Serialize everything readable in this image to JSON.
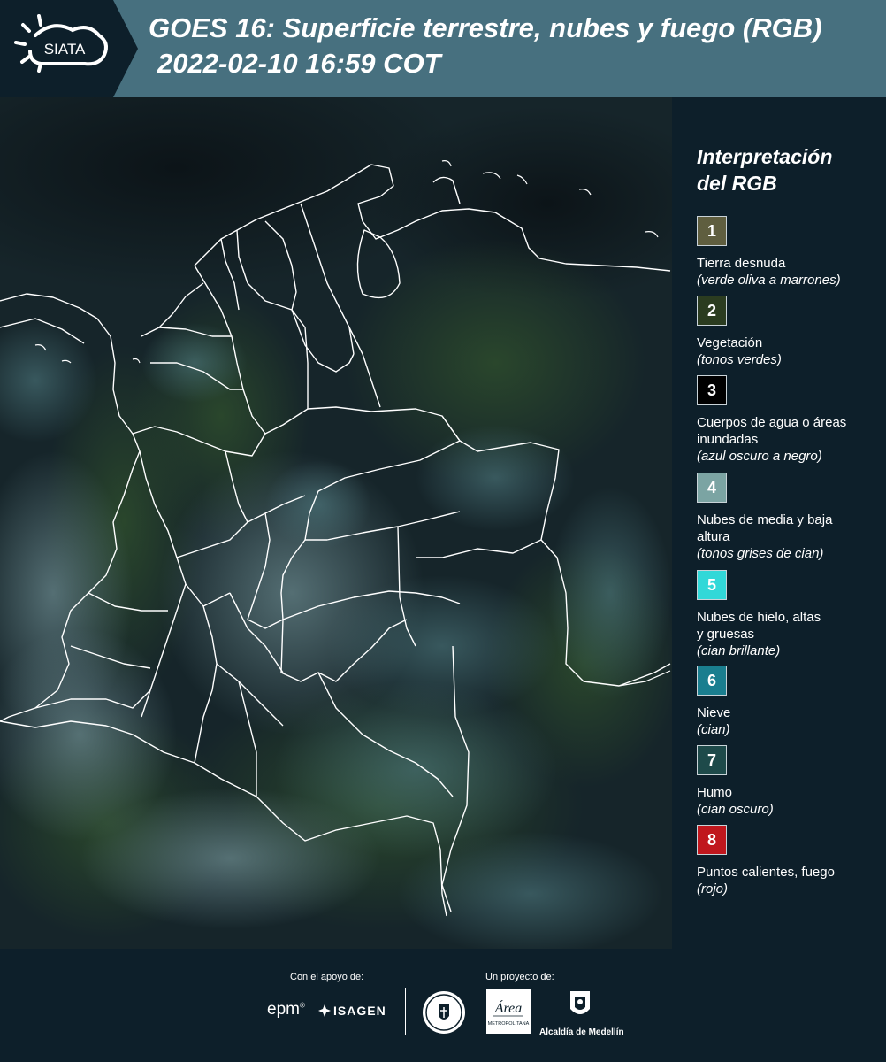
{
  "header": {
    "logo_text": "SIATA",
    "title_line1": "GOES 16: Superficie terrestre, nubes y fuego (RGB)",
    "title_line2": "2022-02-10 16:59 COT"
  },
  "colors": {
    "header_bg": "#47707f",
    "page_bg": "#0d1f2a",
    "map_bg": "#101c1d",
    "boundary": "#ffffff"
  },
  "legend": {
    "title_line1": "Interpretación",
    "title_line2": "del RGB",
    "items": [
      {
        "number": "1",
        "label": "Tierra desnuda",
        "description": "(verde oliva a marrones)",
        "color": "#5f5e3f"
      },
      {
        "number": "2",
        "label": "Vegetación",
        "description": "(tonos verdes)",
        "color": "#2b3c20"
      },
      {
        "number": "3",
        "label": "Cuerpos de agua o áreas inundadas",
        "description": "(azul oscuro a negro)",
        "color": "#000000"
      },
      {
        "number": "4",
        "label": "Nubes de media y baja altura",
        "description": "(tonos grises de cian)",
        "color": "#7ba4a3"
      },
      {
        "number": "5",
        "label": "Nubes de hielo, altas y gruesas",
        "description": "(cian brillante)",
        "color": "#31d8d8"
      },
      {
        "number": "6",
        "label": "Nieve",
        "description": "(cian)",
        "color": "#1a7e8f"
      },
      {
        "number": "7",
        "label": "Humo",
        "description": "(cian oscuro)",
        "color": "#1e4a4a"
      },
      {
        "number": "8",
        "label": "Puntos calientes, fuego",
        "description": "(rojo)",
        "color": "#c0171d"
      }
    ]
  },
  "footer": {
    "support_label": "Con el apoyo de:",
    "project_label": "Un proyecto de:",
    "epm_text": "epm",
    "isagen_text": "ISAGEN",
    "area_logo_text": "Área",
    "area_logo_sub": "METROPOLITANA",
    "medellin_text": "Alcaldía de Medellín"
  }
}
